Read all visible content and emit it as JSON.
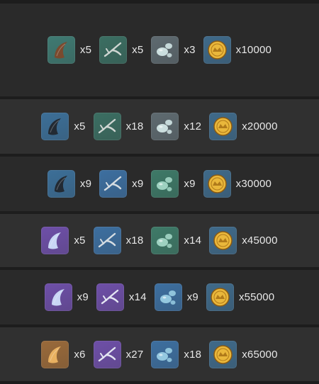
{
  "rows": [
    {
      "items": [
        {
          "icon": "horn-icon",
          "bg": "#3f7a72",
          "glyph": "#7a4a2e",
          "qty": "x5"
        },
        {
          "icon": "claw-icon",
          "bg": "#3b6e62",
          "glyph": "#cfd6d2",
          "qty": "x5"
        },
        {
          "icon": "droplet-icon",
          "bg": "#5e6a70",
          "glyph": "#d8ecec",
          "qty": "x3"
        },
        {
          "icon": "mora-coin-icon",
          "bg": "#3f6a8a",
          "glyph": "#e9b73b",
          "qty": "x10000"
        }
      ]
    },
    {
      "items": [
        {
          "icon": "horn-icon",
          "bg": "#3c6f98",
          "glyph": "#222a33",
          "qty": "x5"
        },
        {
          "icon": "claw-icon",
          "bg": "#3b6e62",
          "glyph": "#cfd6d2",
          "qty": "x18"
        },
        {
          "icon": "droplet-icon",
          "bg": "#5e6a70",
          "glyph": "#d8ecec",
          "qty": "x12"
        },
        {
          "icon": "mora-coin-icon",
          "bg": "#3f6a8a",
          "glyph": "#e9b73b",
          "qty": "x20000"
        }
      ]
    },
    {
      "items": [
        {
          "icon": "horn-icon",
          "bg": "#3c6f98",
          "glyph": "#222a33",
          "qty": "x9"
        },
        {
          "icon": "claw-icon",
          "bg": "#3d6fa0",
          "glyph": "#d6dde2",
          "qty": "x9"
        },
        {
          "icon": "droplet-icon",
          "bg": "#3e7a68",
          "glyph": "#a9dccb",
          "qty": "x9"
        },
        {
          "icon": "mora-coin-icon",
          "bg": "#3f6a8a",
          "glyph": "#e9b73b",
          "qty": "x30000"
        }
      ]
    },
    {
      "items": [
        {
          "icon": "horn-icon",
          "bg": "#6e4fa8",
          "glyph": "#c9d6f5",
          "qty": "x5"
        },
        {
          "icon": "claw-icon",
          "bg": "#3d6fa0",
          "glyph": "#d6dde2",
          "qty": "x18"
        },
        {
          "icon": "droplet-icon",
          "bg": "#3e7a68",
          "glyph": "#a9dccb",
          "qty": "x14"
        },
        {
          "icon": "mora-coin-icon",
          "bg": "#3f6a8a",
          "glyph": "#e9b73b",
          "qty": "x45000"
        }
      ]
    },
    {
      "items": [
        {
          "icon": "horn-icon",
          "bg": "#6e4fa8",
          "glyph": "#c9d6f5",
          "qty": "x9"
        },
        {
          "icon": "claw-icon",
          "bg": "#6e4fa8",
          "glyph": "#e4e6f2",
          "qty": "x14"
        },
        {
          "icon": "droplet-icon",
          "bg": "#3d6fa0",
          "glyph": "#9fd3e8",
          "qty": "x9"
        },
        {
          "icon": "mora-coin-icon",
          "bg": "#3f6a8a",
          "glyph": "#e9b73b",
          "qty": "x55000"
        }
      ]
    },
    {
      "items": [
        {
          "icon": "horn-icon",
          "bg": "#9a6a3a",
          "glyph": "#e8b060",
          "qty": "x6"
        },
        {
          "icon": "claw-icon",
          "bg": "#6e4fa8",
          "glyph": "#e4e6f2",
          "qty": "x27"
        },
        {
          "icon": "droplet-icon",
          "bg": "#3d6fa0",
          "glyph": "#9fd3e8",
          "qty": "x18"
        },
        {
          "icon": "mora-coin-icon",
          "bg": "#3f6a8a",
          "glyph": "#e9b73b",
          "qty": "x65000"
        }
      ]
    }
  ]
}
